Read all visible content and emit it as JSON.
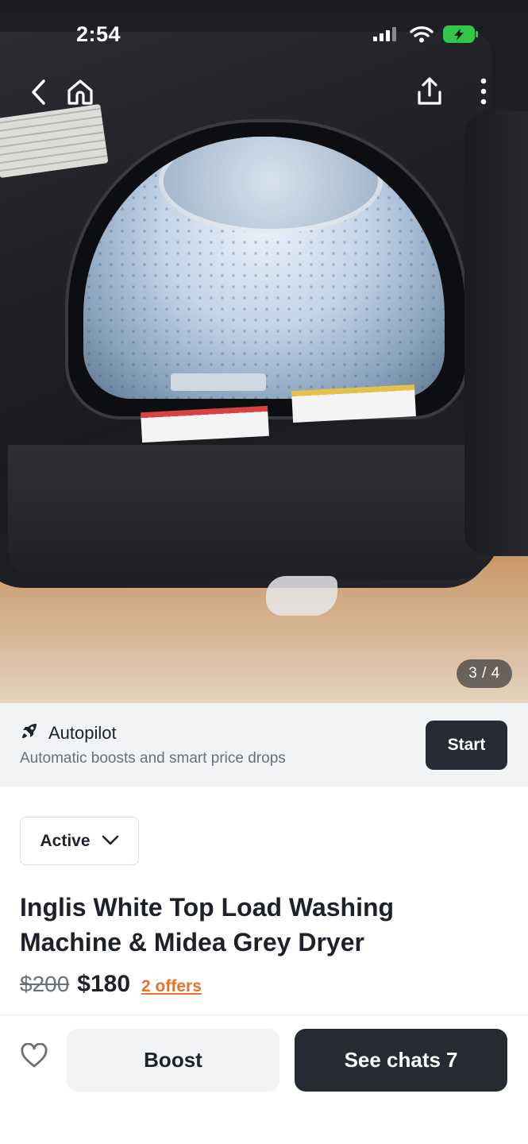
{
  "status_bar": {
    "time": "2:54",
    "icons": [
      "cellular-signal-icon",
      "wifi-icon",
      "battery-charging-icon"
    ]
  },
  "photo": {
    "counter": "3 / 4",
    "icons": [
      "back-icon",
      "home-icon",
      "share-icon",
      "more-icon"
    ]
  },
  "autopilot": {
    "title": "Autopilot",
    "subtitle": "Automatic boosts and smart price drops",
    "start_label": "Start",
    "icon": "rocket-icon"
  },
  "listing": {
    "status": "Active",
    "title": "Inglis White Top Load Washing Machine & Midea Grey Dryer",
    "price_original": "$200",
    "price_current": "$180",
    "offers": "2 offers"
  },
  "bottom_bar": {
    "boost_label": "Boost",
    "chats_label": "See chats",
    "chats_count": "7",
    "favorite_icon": "heart-icon"
  },
  "colors": {
    "accent_offers": "#e8702a",
    "primary_dark": "#262a33",
    "banner_bg": "#f2f3f5"
  }
}
